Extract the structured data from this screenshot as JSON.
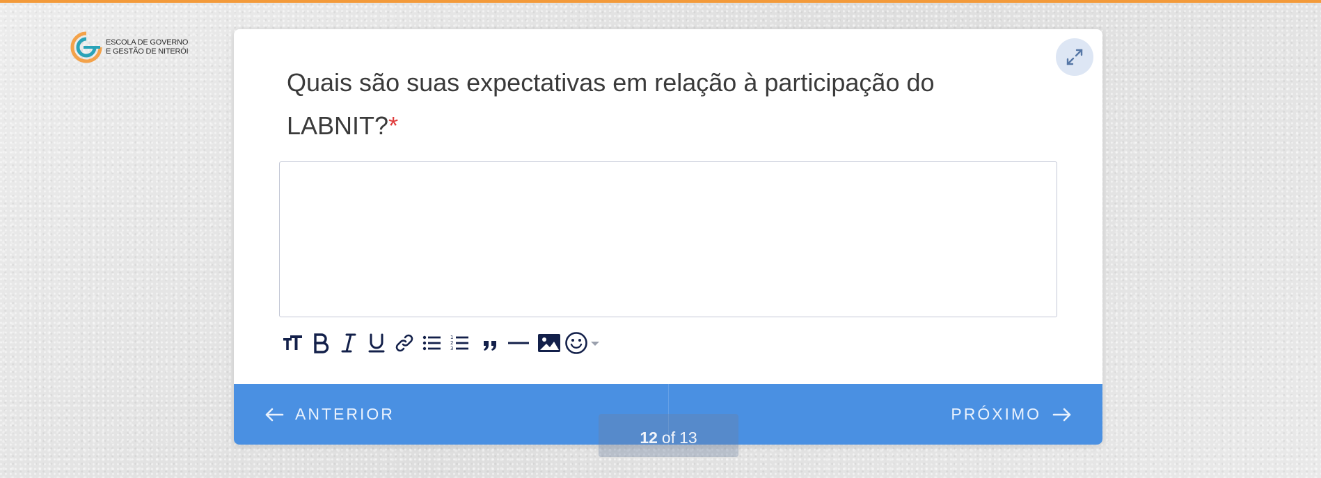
{
  "logo": {
    "line1": "ESCOLA DE GOVERNO",
    "line2": "E GESTÃO DE NITERÓI"
  },
  "question": {
    "text": "Quais são suas expectativas em relação à participação do LABNIT?",
    "required_mark": "*"
  },
  "answer": {
    "value": ""
  },
  "toolbar": {
    "items": [
      "text-size-icon",
      "bold-icon",
      "italic-icon",
      "underline-icon",
      "link-icon",
      "bullet-list-icon",
      "numbered-list-icon",
      "quote-icon",
      "horizontal-rule-icon",
      "image-icon",
      "emoji-icon"
    ]
  },
  "nav": {
    "prev_label": "ANTERIOR",
    "next_label": "PRÓXIMO"
  },
  "pager": {
    "current": "12",
    "of": "of",
    "total": "13"
  },
  "colors": {
    "accent": "#4a90e2",
    "top_bar": "#f39a3a",
    "required": "#e03c3c",
    "icon": "#13204a"
  }
}
